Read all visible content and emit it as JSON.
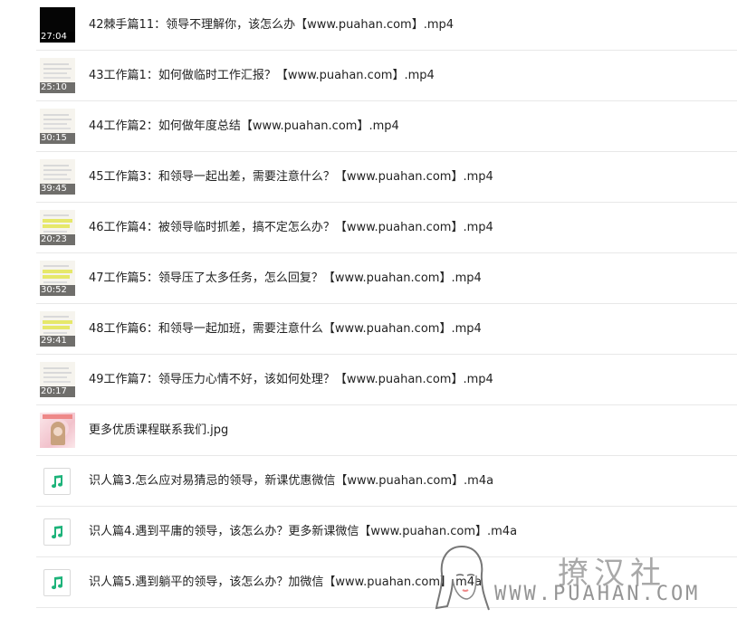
{
  "files": [
    {
      "kind": "video",
      "style": "video-dark",
      "duration": "27:04",
      "name": "42棘手篇11：领导不理解你，该怎么办【www.puahan.com】.mp4"
    },
    {
      "kind": "video",
      "style": "video-doc",
      "duration": "25:10",
      "name": "43工作篇1：如何做临时工作汇报？【www.puahan.com】.mp4"
    },
    {
      "kind": "video",
      "style": "video-doc",
      "duration": "30:15",
      "name": "44工作篇2：如何做年度总结【www.puahan.com】.mp4"
    },
    {
      "kind": "video",
      "style": "video-doc",
      "duration": "39:45",
      "name": "45工作篇3：和领导一起出差，需要注意什么？【www.puahan.com】.mp4"
    },
    {
      "kind": "video",
      "style": "video-hl",
      "duration": "20:23",
      "name": "46工作篇4：被领导临时抓差，搞不定怎么办？【www.puahan.com】.mp4"
    },
    {
      "kind": "video",
      "style": "video-hl",
      "duration": "30:52",
      "name": "47工作篇5：领导压了太多任务，怎么回复？【www.puahan.com】.mp4"
    },
    {
      "kind": "video",
      "style": "video-hl",
      "duration": "29:41",
      "name": "48工作篇6：和领导一起加班，需要注意什么【www.puahan.com】.mp4"
    },
    {
      "kind": "video",
      "style": "video-doc",
      "duration": "20:17",
      "name": "49工作篇7：领导压力心情不好，该如何处理？【www.puahan.com】.mp4"
    },
    {
      "kind": "image",
      "style": "img-thumb",
      "name": "更多优质课程联系我们.jpg"
    },
    {
      "kind": "audio",
      "icon": "music-note-icon",
      "name": "识人篇3.怎么应对易猜忌的领导，新课优惠微信【www.puahan.com】.m4a"
    },
    {
      "kind": "audio",
      "icon": "music-note-icon",
      "name": "识人篇4.遇到平庸的领导，该怎么办？更多新课微信【www.puahan.com】.m4a"
    },
    {
      "kind": "audio",
      "icon": "music-note-icon",
      "name": "识人篇5.遇到躺平的领导，该怎么办？加微信【www.puahan.com】.m4a"
    }
  ],
  "watermark": {
    "brand": "撩汉社",
    "url": "WWW.PUAHAN.COM"
  },
  "colors": {
    "audio_icon": "#1db37a",
    "separator": "#e8e8e8",
    "text": "#222222"
  }
}
